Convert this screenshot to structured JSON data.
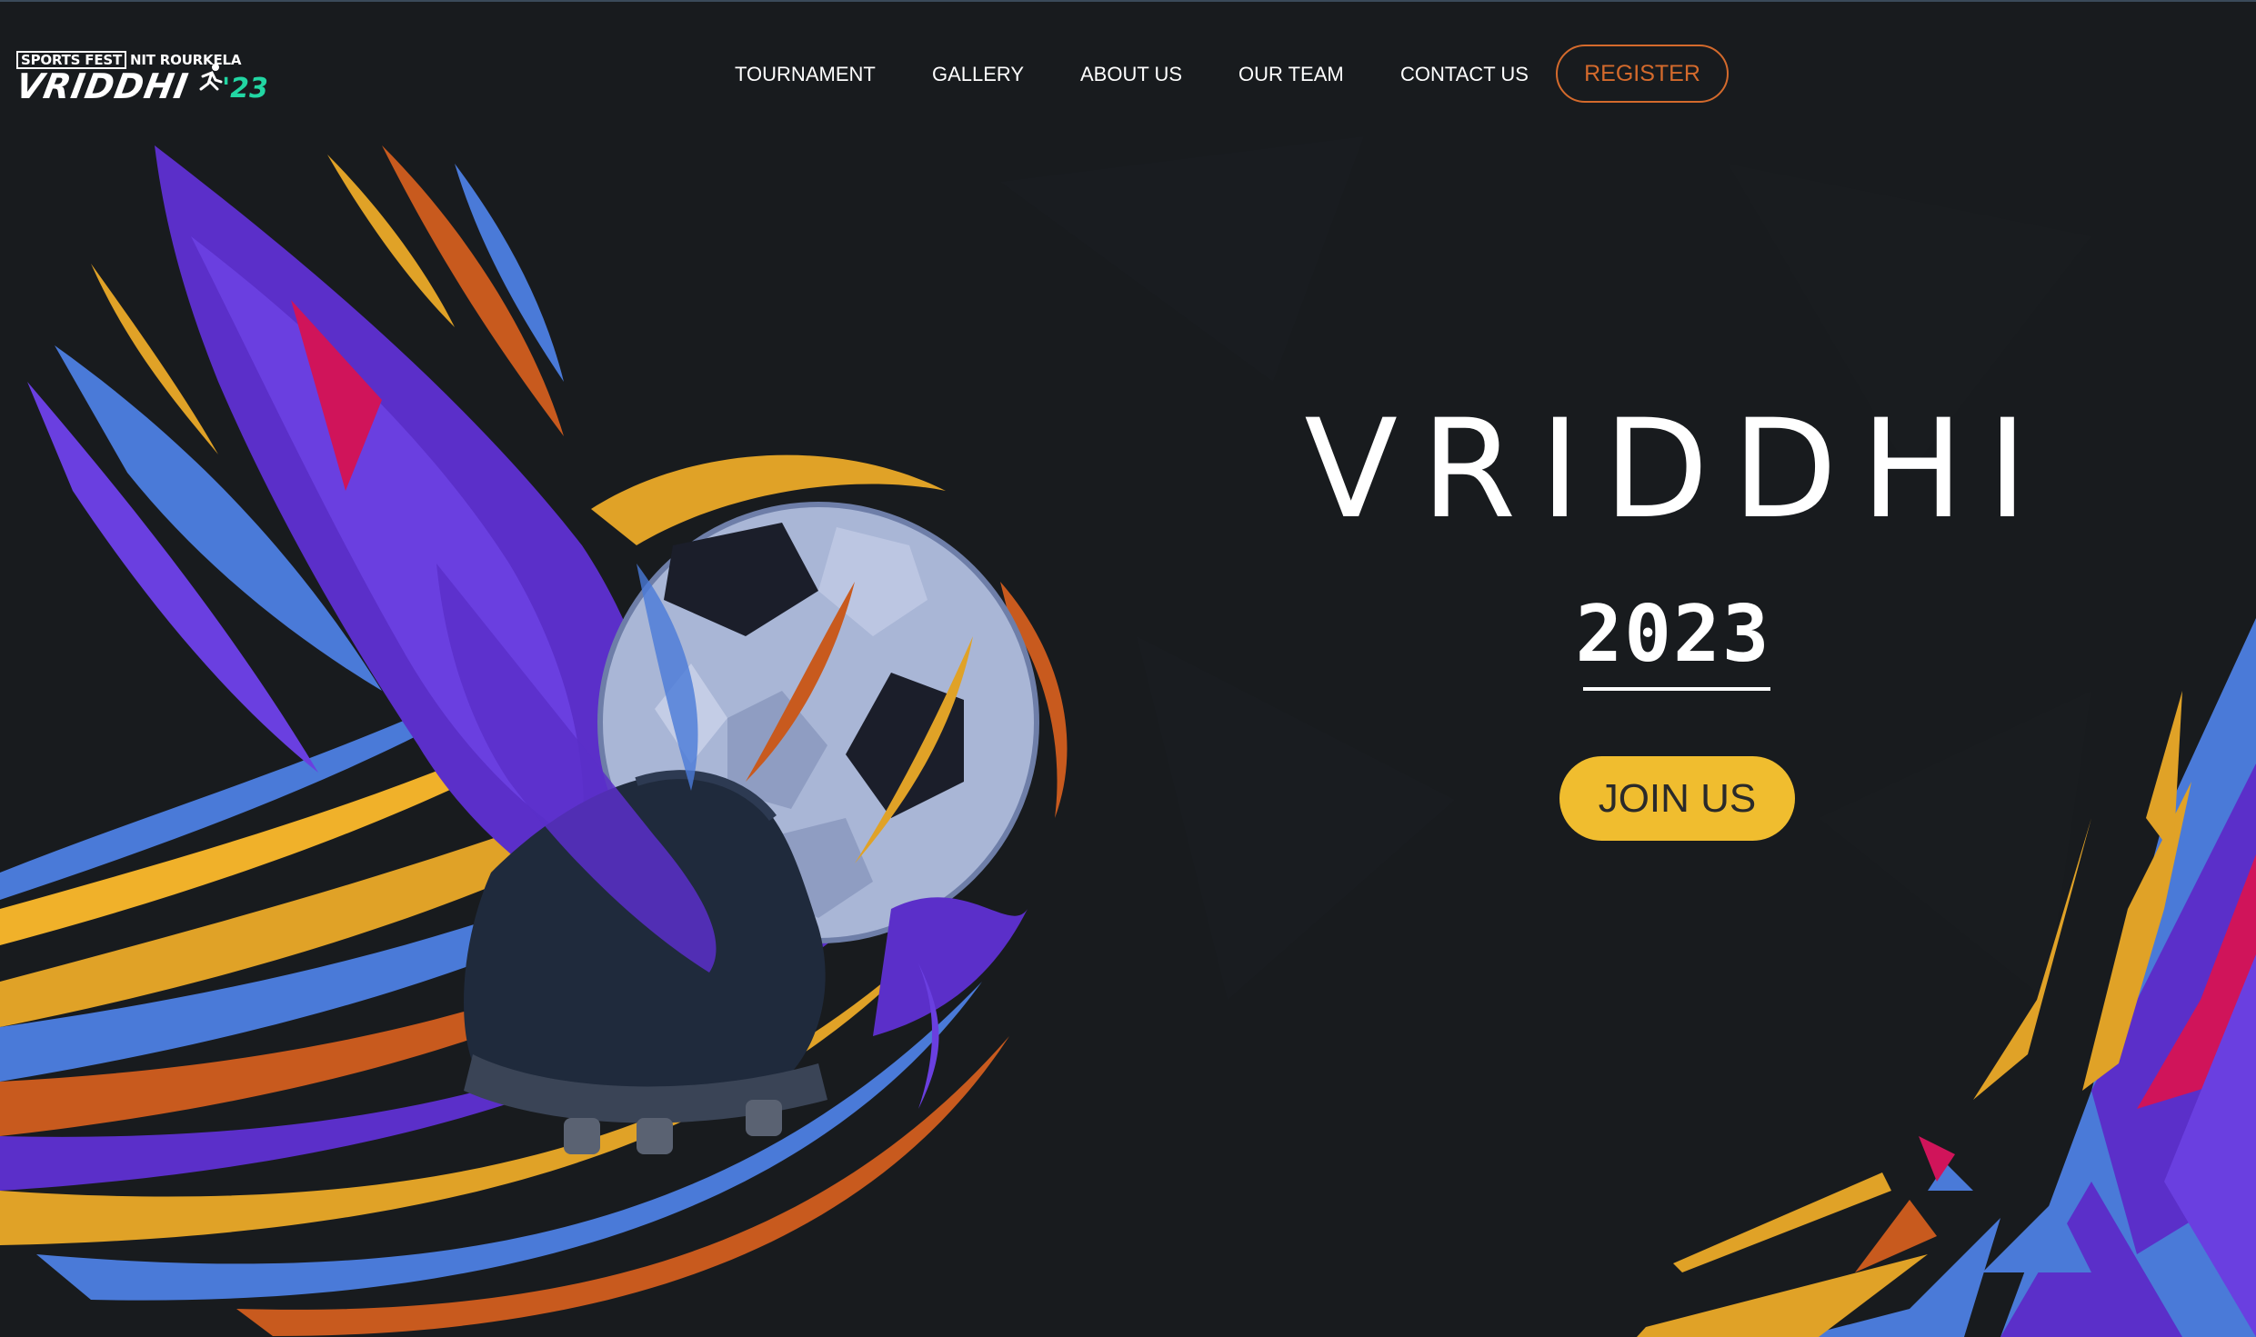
{
  "logo": {
    "top_left": "SPORTS FEST",
    "top_right": "NIT ROURKELA",
    "name": "VRIDDHI",
    "year": "'23"
  },
  "nav": {
    "items": [
      {
        "label": "TOURNAMENT"
      },
      {
        "label": "GALLERY"
      },
      {
        "label": "ABOUT US"
      },
      {
        "label": "OUR TEAM"
      },
      {
        "label": "CONTACT US"
      }
    ],
    "register_label": "REGISTER"
  },
  "hero": {
    "title": "VRIDDHI",
    "year": "2023",
    "cta_label": "JOIN US"
  },
  "colors": {
    "background": "#181b1e",
    "accent_orange": "#d46a2c",
    "cta_yellow": "#f0bd2f",
    "logo_green": "#22d6a3",
    "art_purple": "#5b2fc9",
    "art_blue": "#4a7ad8",
    "art_gold": "#e0a227",
    "art_magenta": "#d0145a"
  },
  "icons": {
    "logo_runner": "runner-icon",
    "hero_art": "football-boot-ball-illustration"
  }
}
